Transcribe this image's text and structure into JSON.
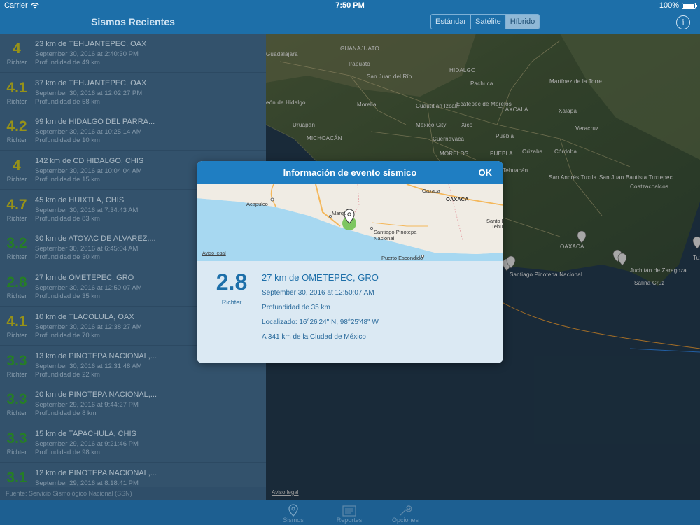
{
  "status": {
    "carrier": "Carrier",
    "time": "7:50 PM",
    "battery": "100%"
  },
  "nav": {
    "title": "Sismos Recientes",
    "segments": [
      "Estándar",
      "Satélite",
      "Híbrido"
    ],
    "active_segment": "Híbrido"
  },
  "colors": {
    "yellow_mag": "#b9b21e",
    "green_mag": "#2f9a2f",
    "accent": "#1d6fa9"
  },
  "quakes": [
    {
      "mag": "4",
      "place": "23 km de TEHUANTEPEC, OAX",
      "date": "September 30, 2016 at 2:40:30 PM",
      "depth": "Profundidad de 49 km",
      "color": "yellow"
    },
    {
      "mag": "4.1",
      "place": "37 km de TEHUANTEPEC, OAX",
      "date": "September 30, 2016 at 12:02:27 PM",
      "depth": "Profundidad de 58 km",
      "color": "yellow"
    },
    {
      "mag": "4.2",
      "place": "99 km de HIDALGO DEL PARRA...",
      "date": "September 30, 2016 at 10:25:14 AM",
      "depth": "Profundidad de 10 km",
      "color": "yellow"
    },
    {
      "mag": "4",
      "place": "142 km de CD HIDALGO, CHIS",
      "date": "September 30, 2016 at 10:04:04 AM",
      "depth": "Profundidad de 15 km",
      "color": "yellow"
    },
    {
      "mag": "4.7",
      "place": "45 km de HUIXTLA, CHIS",
      "date": "September 30, 2016 at 7:34:43 AM",
      "depth": "Profundidad de 83 km",
      "color": "yellow"
    },
    {
      "mag": "3.2",
      "place": "30 km de ATOYAC DE ALVAREZ,...",
      "date": "September 30, 2016 at 6:45:04 AM",
      "depth": "Profundidad de 30 km",
      "color": "green"
    },
    {
      "mag": "2.8",
      "place": "27 km de OMETEPEC, GRO",
      "date": "September 30, 2016 at 12:50:07 AM",
      "depth": "Profundidad de 35 km",
      "color": "green"
    },
    {
      "mag": "4.1",
      "place": "10 km de TLACOLULA, OAX",
      "date": "September 30, 2016 at 12:38:27 AM",
      "depth": "Profundidad de 70 km",
      "color": "yellow"
    },
    {
      "mag": "3.3",
      "place": "13 km de PINOTEPA NACIONAL,...",
      "date": "September 30, 2016 at 12:31:48 AM",
      "depth": "Profundidad de 22 km",
      "color": "green"
    },
    {
      "mag": "3.3",
      "place": "20 km de PINOTEPA NACIONAL,...",
      "date": "September 29, 2016 at 9:44:27 PM",
      "depth": "Profundidad de 8 km",
      "color": "green"
    },
    {
      "mag": "3.3",
      "place": "15 km de TAPACHULA, CHIS",
      "date": "September 29, 2016 at 9:21:46 PM",
      "depth": "Profundidad de 98 km",
      "color": "green"
    },
    {
      "mag": "3.1",
      "place": "12 km de PINOTEPA NACIONAL,...",
      "date": "September 29, 2016 at 8:18:41 PM",
      "depth": "",
      "color": "green"
    }
  ],
  "richter_label": "Richter",
  "source": "Fuente: Servicio Sismológico Nacional (SSN)",
  "map_labels": [
    "Guadalajara",
    "GUANAJUATO",
    "Irapuato",
    "San Juan del Río",
    "HIDALGO",
    "Pachuca",
    "Martínez de la Torre",
    "eón de Hidalgo",
    "Morelia",
    "Cuautitlán Izcalli",
    "Ecatepec de Morelos",
    "TLAXCALA",
    "Xalapa",
    "Uruapan",
    "México City",
    "Xico",
    "Puebla",
    "Veracruz",
    "MICHOACÁN",
    "Cuernavaca",
    "Córdoba",
    "MORELOS",
    "PUEBLA",
    "Orizaba",
    "Tehuacán",
    "San Andrés Tuxtla",
    "San Juan Bautista Tuxtepec",
    "Coatzacoalcos",
    "OAXACA",
    "Juchitán de Zaragoza",
    "Salina Cruz",
    "Santiago Pinotepa Nacional",
    "Tuxtla"
  ],
  "map_legal": "Aviso legal",
  "tabs": [
    "Sismos",
    "Reportes",
    "Opciones"
  ],
  "modal": {
    "title": "Información de evento sísmico",
    "ok": "OK",
    "mag": "2.8",
    "richter": "Richter",
    "place": "27 km de OMETEPEC, GRO",
    "date": "September 30, 2016 at 12:50:07 AM",
    "depth": "Profundidad de 35 km",
    "location": "Localizado: 16°26'24\" N, 98°25'48\" W",
    "distance": "A 341 km de la Ciudad de México",
    "minimap_labels": [
      "Acapulco",
      "Marqu",
      "Oaxaca",
      "OAXACA",
      "Santo D",
      "Tehu",
      "Santiago Pinotepa",
      "Nacional",
      "Puerto Escondido"
    ],
    "minimap_legal": "Aviso legal"
  }
}
